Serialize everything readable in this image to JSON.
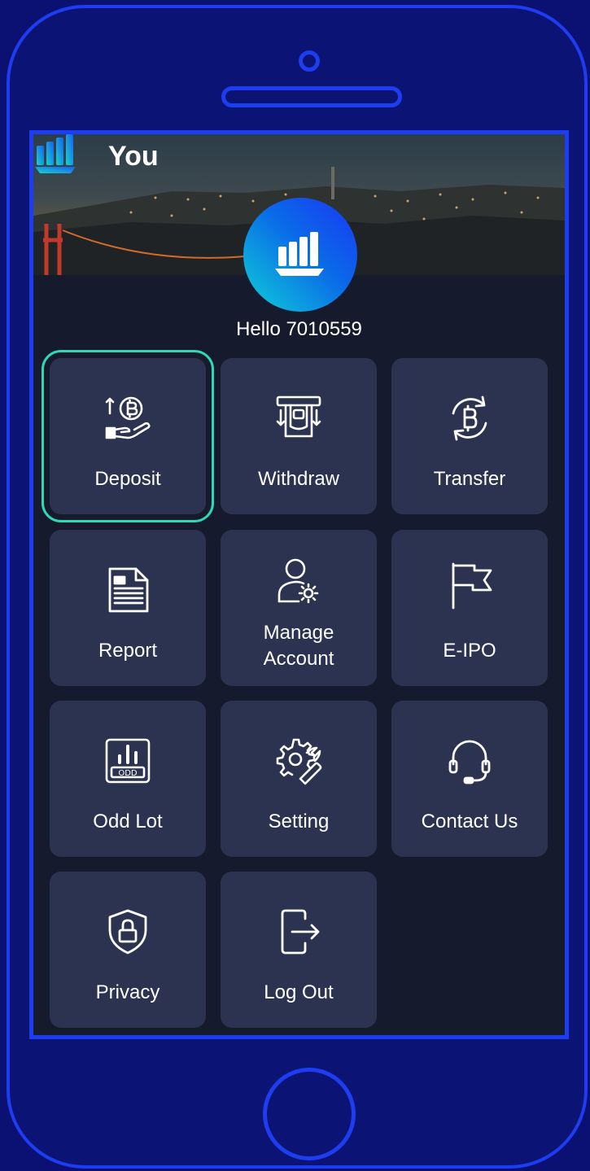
{
  "header": {
    "title": "You"
  },
  "profile": {
    "greeting": "Hello 7010559"
  },
  "menu": [
    {
      "label": "Deposit",
      "icon": "deposit-icon",
      "selected": true
    },
    {
      "label": "Withdraw",
      "icon": "withdraw-icon",
      "selected": false
    },
    {
      "label": "Transfer",
      "icon": "transfer-icon",
      "selected": false
    },
    {
      "label": "Report",
      "icon": "report-icon",
      "selected": false
    },
    {
      "label": "Manage Account",
      "icon": "manage-account-icon",
      "selected": false
    },
    {
      "label": "E-IPO",
      "icon": "flag-icon",
      "selected": false
    },
    {
      "label": "Odd Lot",
      "icon": "odd-lot-icon",
      "selected": false
    },
    {
      "label": "Setting",
      "icon": "settings-icon",
      "selected": false
    },
    {
      "label": "Contact Us",
      "icon": "headset-icon",
      "selected": false
    },
    {
      "label": "Privacy",
      "icon": "privacy-shield-icon",
      "selected": false
    },
    {
      "label": "Log Out",
      "icon": "logout-icon",
      "selected": false
    }
  ],
  "colors": {
    "device_frame": "#1e3cf0",
    "screen_background": "#151b2c",
    "tile_background": "#2b3350",
    "selection_outline": "#2fd8b6"
  }
}
